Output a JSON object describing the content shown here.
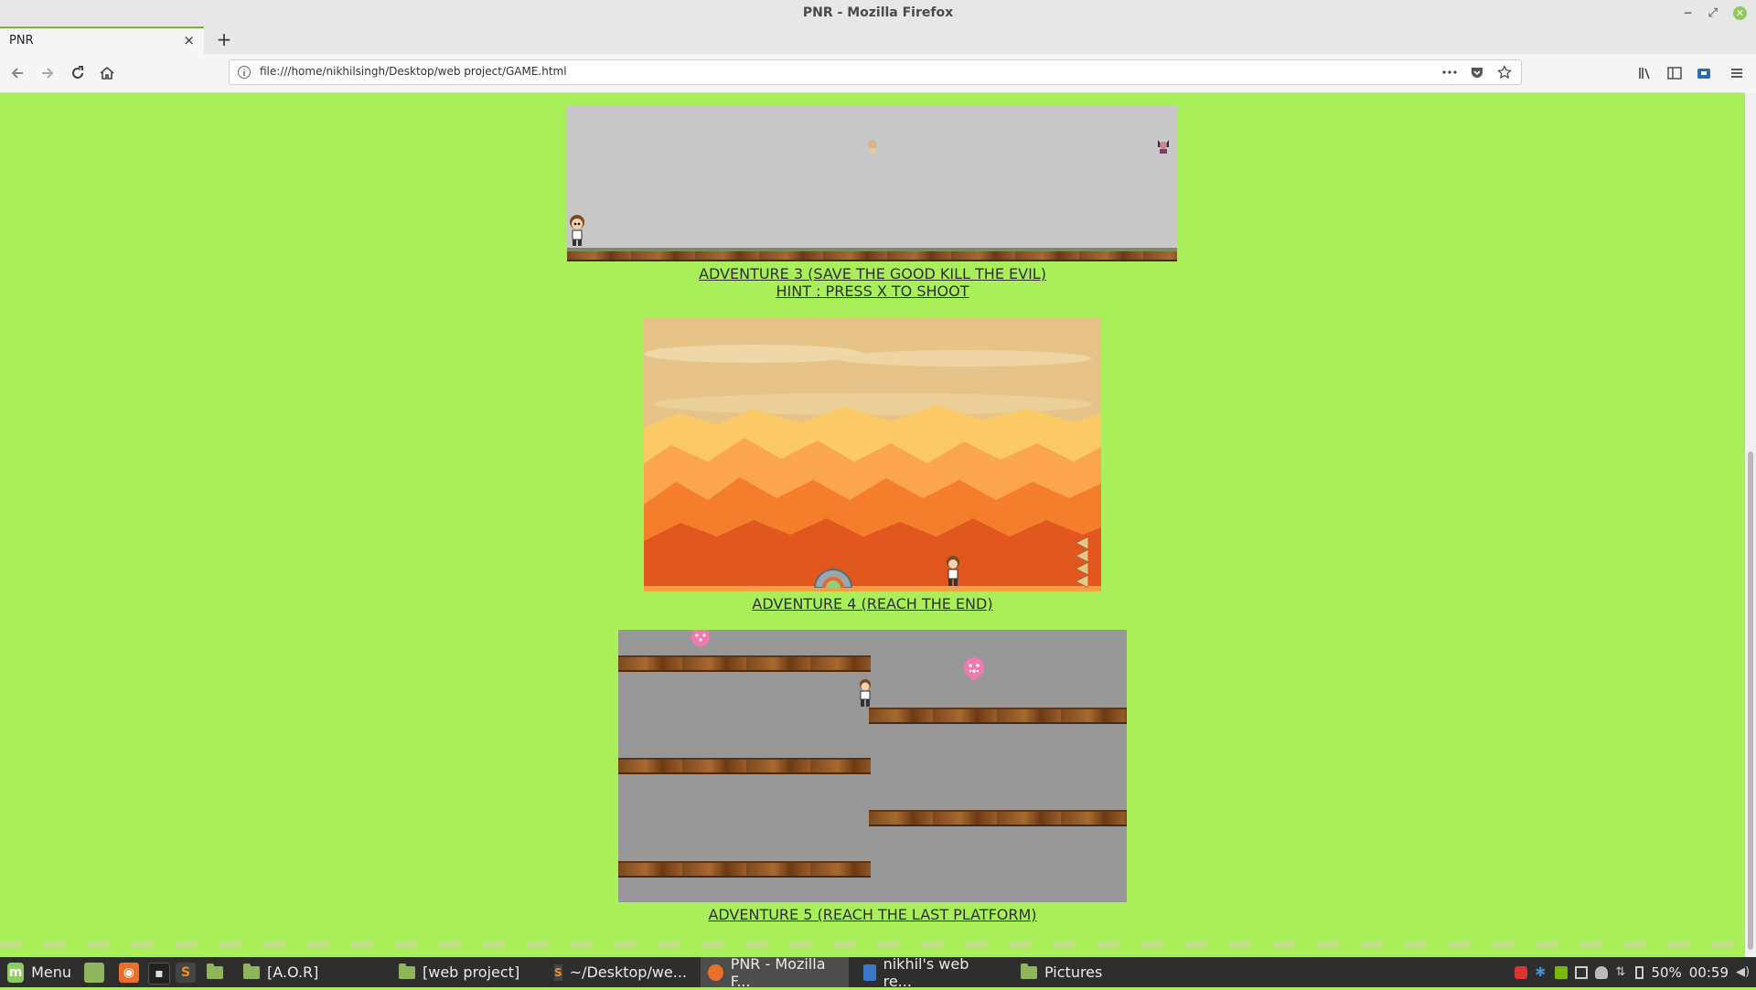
{
  "window": {
    "title": "PNR - Mozilla Firefox",
    "min_icon": "minimize-icon",
    "max_icon": "maximize-icon",
    "close_icon": "close-icon"
  },
  "tab": {
    "title": "PNR",
    "close": "×",
    "new_tab": "+"
  },
  "nav": {
    "url": "file:///home/nikhilsingh/Desktop/web project/GAME.html",
    "icons": [
      "back-icon",
      "forward-icon",
      "reload-icon",
      "home-icon",
      "info-icon",
      "more-icon",
      "pocket-icon",
      "bookmark-star-icon",
      "library-icon",
      "sidebar-icon",
      "extension-icon",
      "menu-icon"
    ]
  },
  "games": [
    {
      "caption_line1": "ADVENTURE 3 (SAVE THE GOOD KILL THE EVIL)",
      "caption_line2": "HINT : PRESS X TO SHOOT"
    },
    {
      "caption": "ADVENTURE 4 (REACH THE END)"
    },
    {
      "caption": "ADVENTURE 5 (REACH THE LAST PLATFORM)"
    }
  ],
  "taskbar": {
    "menu_label": "Menu",
    "items": [
      {
        "label": "[A.O.R]",
        "icon": "folder-icon"
      },
      {
        "label": "[web project]",
        "icon": "folder-icon"
      },
      {
        "label": "~/Desktop/we...",
        "icon": "sublime-icon"
      },
      {
        "label": "PNR - Mozilla F...",
        "icon": "firefox-icon"
      },
      {
        "label": "nikhil's web re...",
        "icon": "document-icon"
      },
      {
        "label": "Pictures",
        "icon": "folder-icon"
      }
    ],
    "battery": "50%",
    "clock": "00:59"
  },
  "colors": {
    "page_bg": "#a8ef59",
    "link": "#303030",
    "taskbar": "#2e2e2e"
  }
}
